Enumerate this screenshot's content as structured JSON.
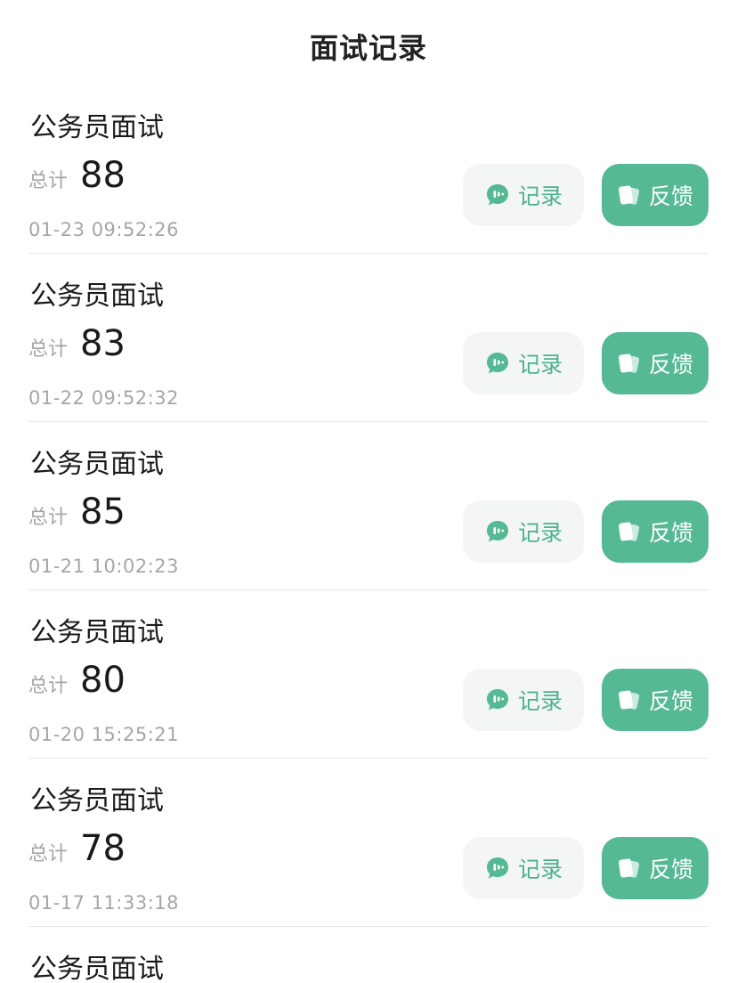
{
  "header": {
    "title": "面试记录"
  },
  "colors": {
    "accent": "#55b993",
    "accent_text": "#4bb38d",
    "muted": "#a6a6a6"
  },
  "icons": {
    "record": "chat-bubble-icon",
    "feedback": "cards-icon"
  },
  "records": [
    {
      "title": "公务员面试",
      "score_label": "总计",
      "score": "88",
      "time": "01-23 09:52:26",
      "record_label": "记录",
      "feedback_label": "反馈"
    },
    {
      "title": "公务员面试",
      "score_label": "总计",
      "score": "83",
      "time": "01-22 09:52:32",
      "record_label": "记录",
      "feedback_label": "反馈"
    },
    {
      "title": "公务员面试",
      "score_label": "总计",
      "score": "85",
      "time": "01-21 10:02:23",
      "record_label": "记录",
      "feedback_label": "反馈"
    },
    {
      "title": "公务员面试",
      "score_label": "总计",
      "score": "80",
      "time": "01-20 15:25:21",
      "record_label": "记录",
      "feedback_label": "反馈"
    },
    {
      "title": "公务员面试",
      "score_label": "总计",
      "score": "78",
      "time": "01-17 11:33:18",
      "record_label": "记录",
      "feedback_label": "反馈"
    },
    {
      "title": "公务员面试"
    }
  ]
}
